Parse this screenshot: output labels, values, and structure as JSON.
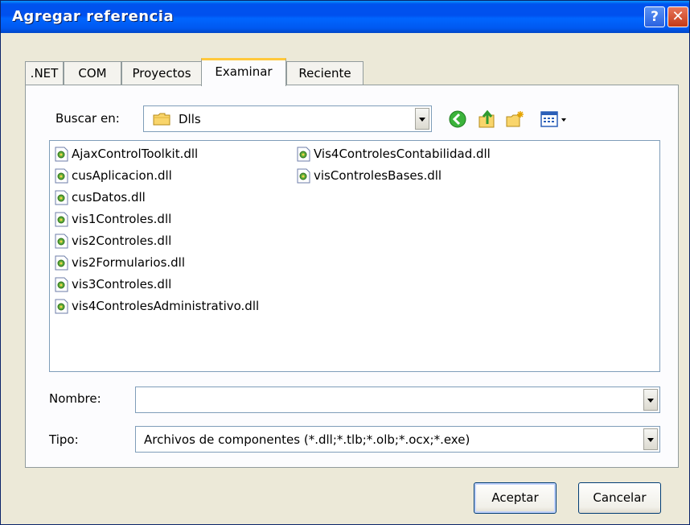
{
  "dialog": {
    "title": "Agregar referencia",
    "help_glyph": "?",
    "close_glyph": "✕"
  },
  "tabs": [
    {
      "label": ".NET",
      "active": false
    },
    {
      "label": "COM",
      "active": false
    },
    {
      "label": "Proyectos",
      "active": false
    },
    {
      "label": "Examinar",
      "active": true
    },
    {
      "label": "Reciente",
      "active": false
    }
  ],
  "lookin": {
    "label": "Buscar en:",
    "value": "Dlls",
    "icon": "folder-icon"
  },
  "toolbar": {
    "back_icon": "back-icon",
    "up_icon": "up-folder-icon",
    "new_folder_icon": "new-folder-icon",
    "views_icon": "views-menu-icon"
  },
  "files": [
    "AjaxControlToolkit.dll",
    "cusAplicacion.dll",
    "cusDatos.dll",
    "vis1Controles.dll",
    "vis2Controles.dll",
    "vis2Formularios.dll",
    "vis3Controles.dll",
    "vis4ControlesAdministrativo.dll",
    "Vis4ControlesContabilidad.dll",
    "visControlesBases.dll"
  ],
  "filename": {
    "label": "Nombre:",
    "value": ""
  },
  "filetype": {
    "label": "Tipo:",
    "value": "Archivos de componentes (*.dll;*.tlb;*.olb;*.ocx;*.exe)"
  },
  "buttons": {
    "ok": "Aceptar",
    "cancel": "Cancelar"
  }
}
